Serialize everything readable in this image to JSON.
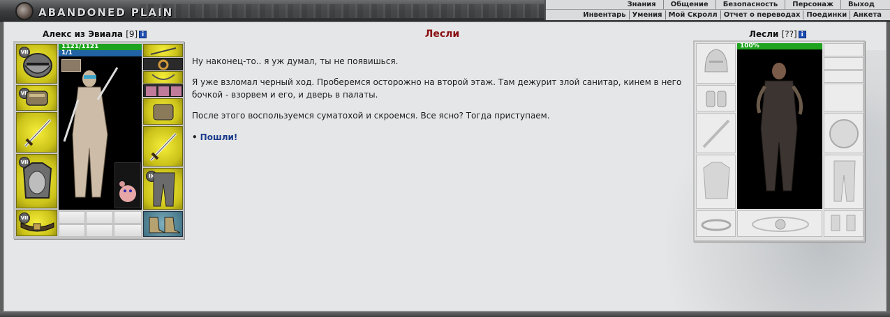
{
  "header": {
    "logo_text": "ABANDONED PLAIN",
    "nav_top": [
      "Знания",
      "Общение",
      "Безопасность",
      "Персонаж",
      "Выход"
    ],
    "nav_bottom": [
      "Инвентарь",
      "Умения",
      "Мой Скролл",
      "Отчет о переводах",
      "Поединки",
      "Анкета"
    ]
  },
  "player": {
    "name": "Алекс из Эвиала",
    "level": "[9]",
    "info_icon": "i",
    "hp": "1121/1121",
    "mana": "1/1",
    "slot_badges": [
      "VII",
      "VII",
      "VII",
      "VII",
      "IX"
    ]
  },
  "npc": {
    "name": "Лесли",
    "level": "[??]",
    "info_icon": "i",
    "hp": "100%"
  },
  "dialog": {
    "title": "Лесли",
    "paragraphs": [
      "Ну наконец-то.. я уж думал, ты не появишься.",
      "Я уже взломал черный ход. Проберемся осторожно на второй этаж. Там дежурит злой санитар, кинем в него бочкой - взорвем и его, и дверь в палаты.",
      "После этого воспользуемся суматохой и скроемся. Все ясно? Тогда приступаем."
    ],
    "choice_bullet": "•",
    "choice": "Пошли!"
  },
  "colors": {
    "title_red": "#8a0f12",
    "link_blue": "#1a3b8c",
    "hp_green": "#1ea31e",
    "mana_blue": "#2163a3",
    "slot_yellow": "#e3da22"
  }
}
